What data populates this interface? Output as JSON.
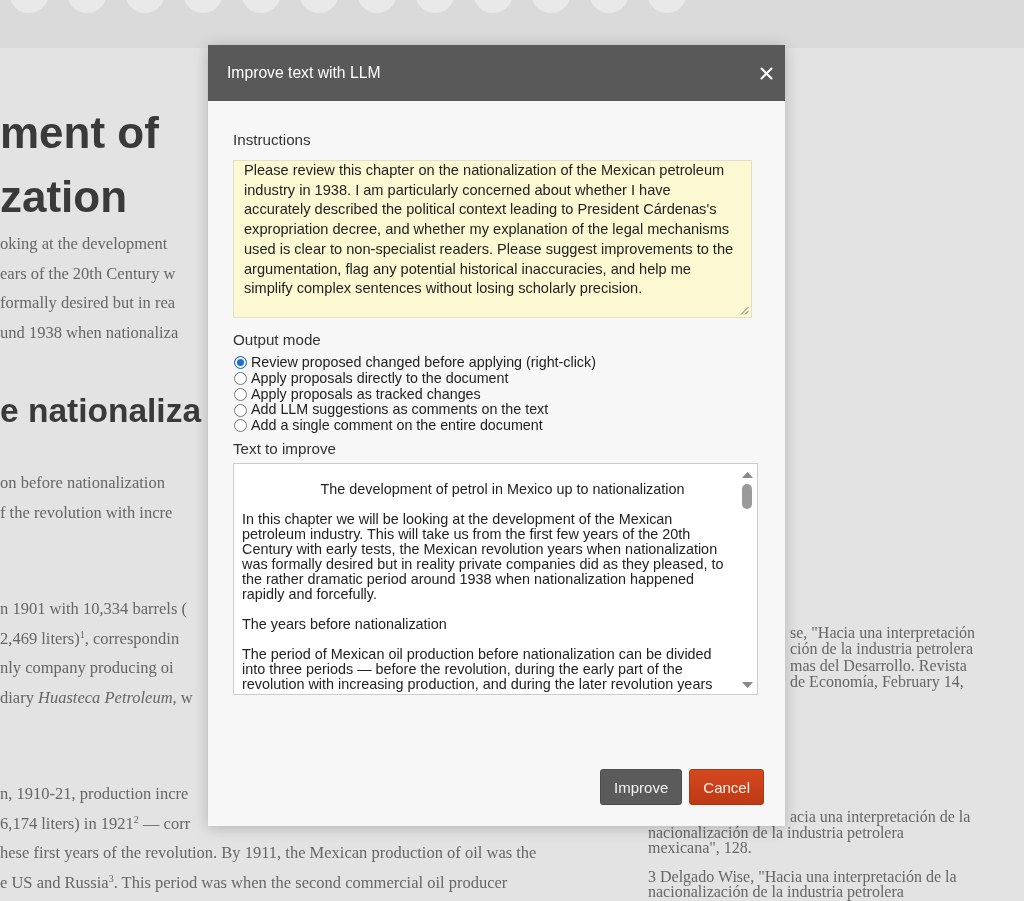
{
  "background": {
    "left_column": [
      {
        "kind": "heading1",
        "lines": [
          "ment of",
          "zation"
        ]
      },
      {
        "kind": "body",
        "lines": [
          "oking at the development",
          "ears of the 20th Century w",
          "formally desired but in rea",
          "und 1938 when nationaliza"
        ]
      },
      {
        "kind": "heading2",
        "lines": [
          "e nationaliza"
        ]
      },
      {
        "kind": "body",
        "lines": [
          "on before nationalization",
          "f the revolution with incre"
        ]
      },
      {
        "kind": "body",
        "lines": [
          "n 1901 with 10,334 barrels (",
          "2,469 liters)$^{1}$, correspondin",
          "nly company producing oi",
          "diary *Huasteca Petroleum*, w"
        ]
      },
      {
        "kind": "body",
        "lines": [
          "n, 1910-21, production incre",
          "6,174 liters) in 1921$^{2}$ — corr",
          "hese first years of the revolution. By 1911, the Mexican production of oil was the",
          "e US and Russia$^{3}$. This period was when the second commercial oil producer"
        ]
      }
    ],
    "right_column": {
      "upper": [
        {
          "lines": [
            "se, \"Hacia una interpretación",
            "ción de la industria petrolera",
            "mas del Desarrollo. Revista",
            "de Economía, February 14,"
          ]
        },
        {
          "lines": [
            "acia una interpretación de la"
          ]
        }
      ],
      "lower": [
        {
          "lines": [
            "nacionalización de la industria petrolera",
            "mexicana\", 128."
          ]
        },
        {
          "lines": [
            "3 Delgado Wise, \"Hacia una interpretación de la",
            "nacionalización de la industria petrolera"
          ]
        }
      ]
    }
  },
  "dialog": {
    "title": "Improve text with LLM",
    "instructions": {
      "label": "Instructions",
      "value": "Please review this chapter on the nationalization of the Mexican petroleum industry in 1938. I am particularly concerned about whether I have accurately described the political context leading to President Cárdenas's expropriation decree, and whether my explanation of the legal mechanisms used is clear to non-specialist readers. Please suggest improvements to the argumentation, flag any potential historical inaccuracies, and help me simplify complex sentences without losing scholarly precision."
    },
    "output_mode": {
      "label": "Output mode",
      "options": [
        {
          "label": "Review proposed changed before applying (right-click)",
          "selected": true
        },
        {
          "label": "Apply proposals directly to the document",
          "selected": false
        },
        {
          "label": "Apply proposals as tracked changes",
          "selected": false
        },
        {
          "label": "Add LLM suggestions as comments on the text",
          "selected": false
        },
        {
          "label": "Add a single comment on the entire document",
          "selected": false
        }
      ]
    },
    "text_to_improve": {
      "label": "Text to improve",
      "title": "The development of petrol in Mexico up to nationalization",
      "paragraphs": [
        "In this chapter we will be looking at the development of the Mexican petroleum industry. This will take us from the first few years of the 20th Century with early tests, the Mexican revolution years when nationalization was formally desired but in reality private companies did as they pleased, to the rather dramatic period around 1938 when nationalization happened rapidly and forcefully.",
        "The years before nationalization",
        "The period of Mexican oil production before nationalization can be divided into three periods — before the revolution, during the early part of the revolution with increasing production, and during the later revolution years"
      ]
    },
    "buttons": [
      {
        "kind": "submit",
        "label": "Improve"
      },
      {
        "kind": "cancel",
        "label": "Cancel"
      }
    ]
  }
}
